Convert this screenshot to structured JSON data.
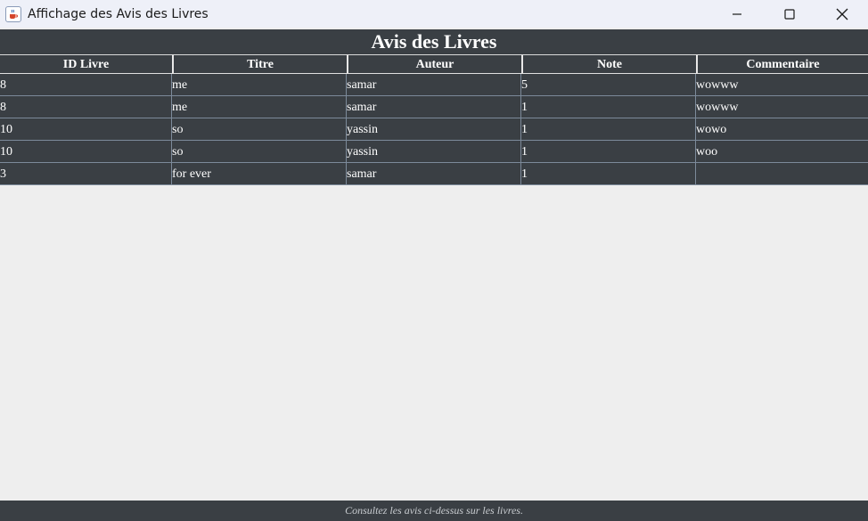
{
  "window": {
    "title": "Affichage des Avis des Livres",
    "app_icon": "java-cup-icon",
    "controls": [
      "minimize-icon",
      "maximize-icon",
      "close-icon"
    ]
  },
  "header": {
    "title": "Avis des Livres"
  },
  "table": {
    "columns": [
      "ID Livre",
      "Titre",
      "Auteur",
      "Note",
      "Commentaire"
    ],
    "rows": [
      [
        "8",
        "me",
        "samar",
        "5",
        "wowww"
      ],
      [
        "8",
        "me",
        "samar",
        "1",
        "wowww"
      ],
      [
        "10",
        "so",
        "yassin",
        "1",
        "wowo"
      ],
      [
        "10",
        "so",
        "yassin",
        "1",
        "woo"
      ],
      [
        "3",
        "for ever",
        "samar",
        "1",
        ""
      ]
    ]
  },
  "footer": {
    "text": "Consultez les avis ci-dessus sur les livres."
  },
  "colors": {
    "titlebar_bg": "#eef0f8",
    "dark_band": "#3a3f44",
    "body_bg": "#eeeeee",
    "text_light": "#ffffff"
  }
}
